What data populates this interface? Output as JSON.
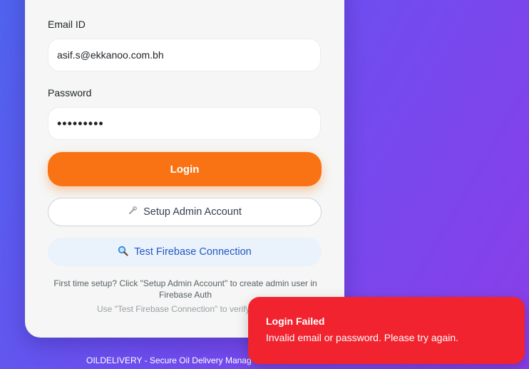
{
  "form": {
    "email_label": "Email ID",
    "email_value": "asif.s@ekkanoo.com.bh",
    "password_label": "Password",
    "password_value": "•••••••••",
    "login_label": "Login",
    "setup_label": "Setup Admin Account",
    "test_label": "Test Firebase Connection",
    "note_line1": "First time setup? Click \"Setup Admin Account\" to create admin user in Firebase Auth",
    "note_line2": "Use \"Test Firebase Connection\" to verify datab"
  },
  "footer": {
    "text": "OILDELIVERY - Secure Oil Delivery Manag"
  },
  "toast": {
    "title": "Login Failed",
    "message": "Invalid email or password. Please try again."
  },
  "icons": {
    "setup": "wrench-icon",
    "test": "magnifier-icon"
  },
  "colors": {
    "primary": "#f97315",
    "error": "#f1232f",
    "link": "#2457c5"
  }
}
